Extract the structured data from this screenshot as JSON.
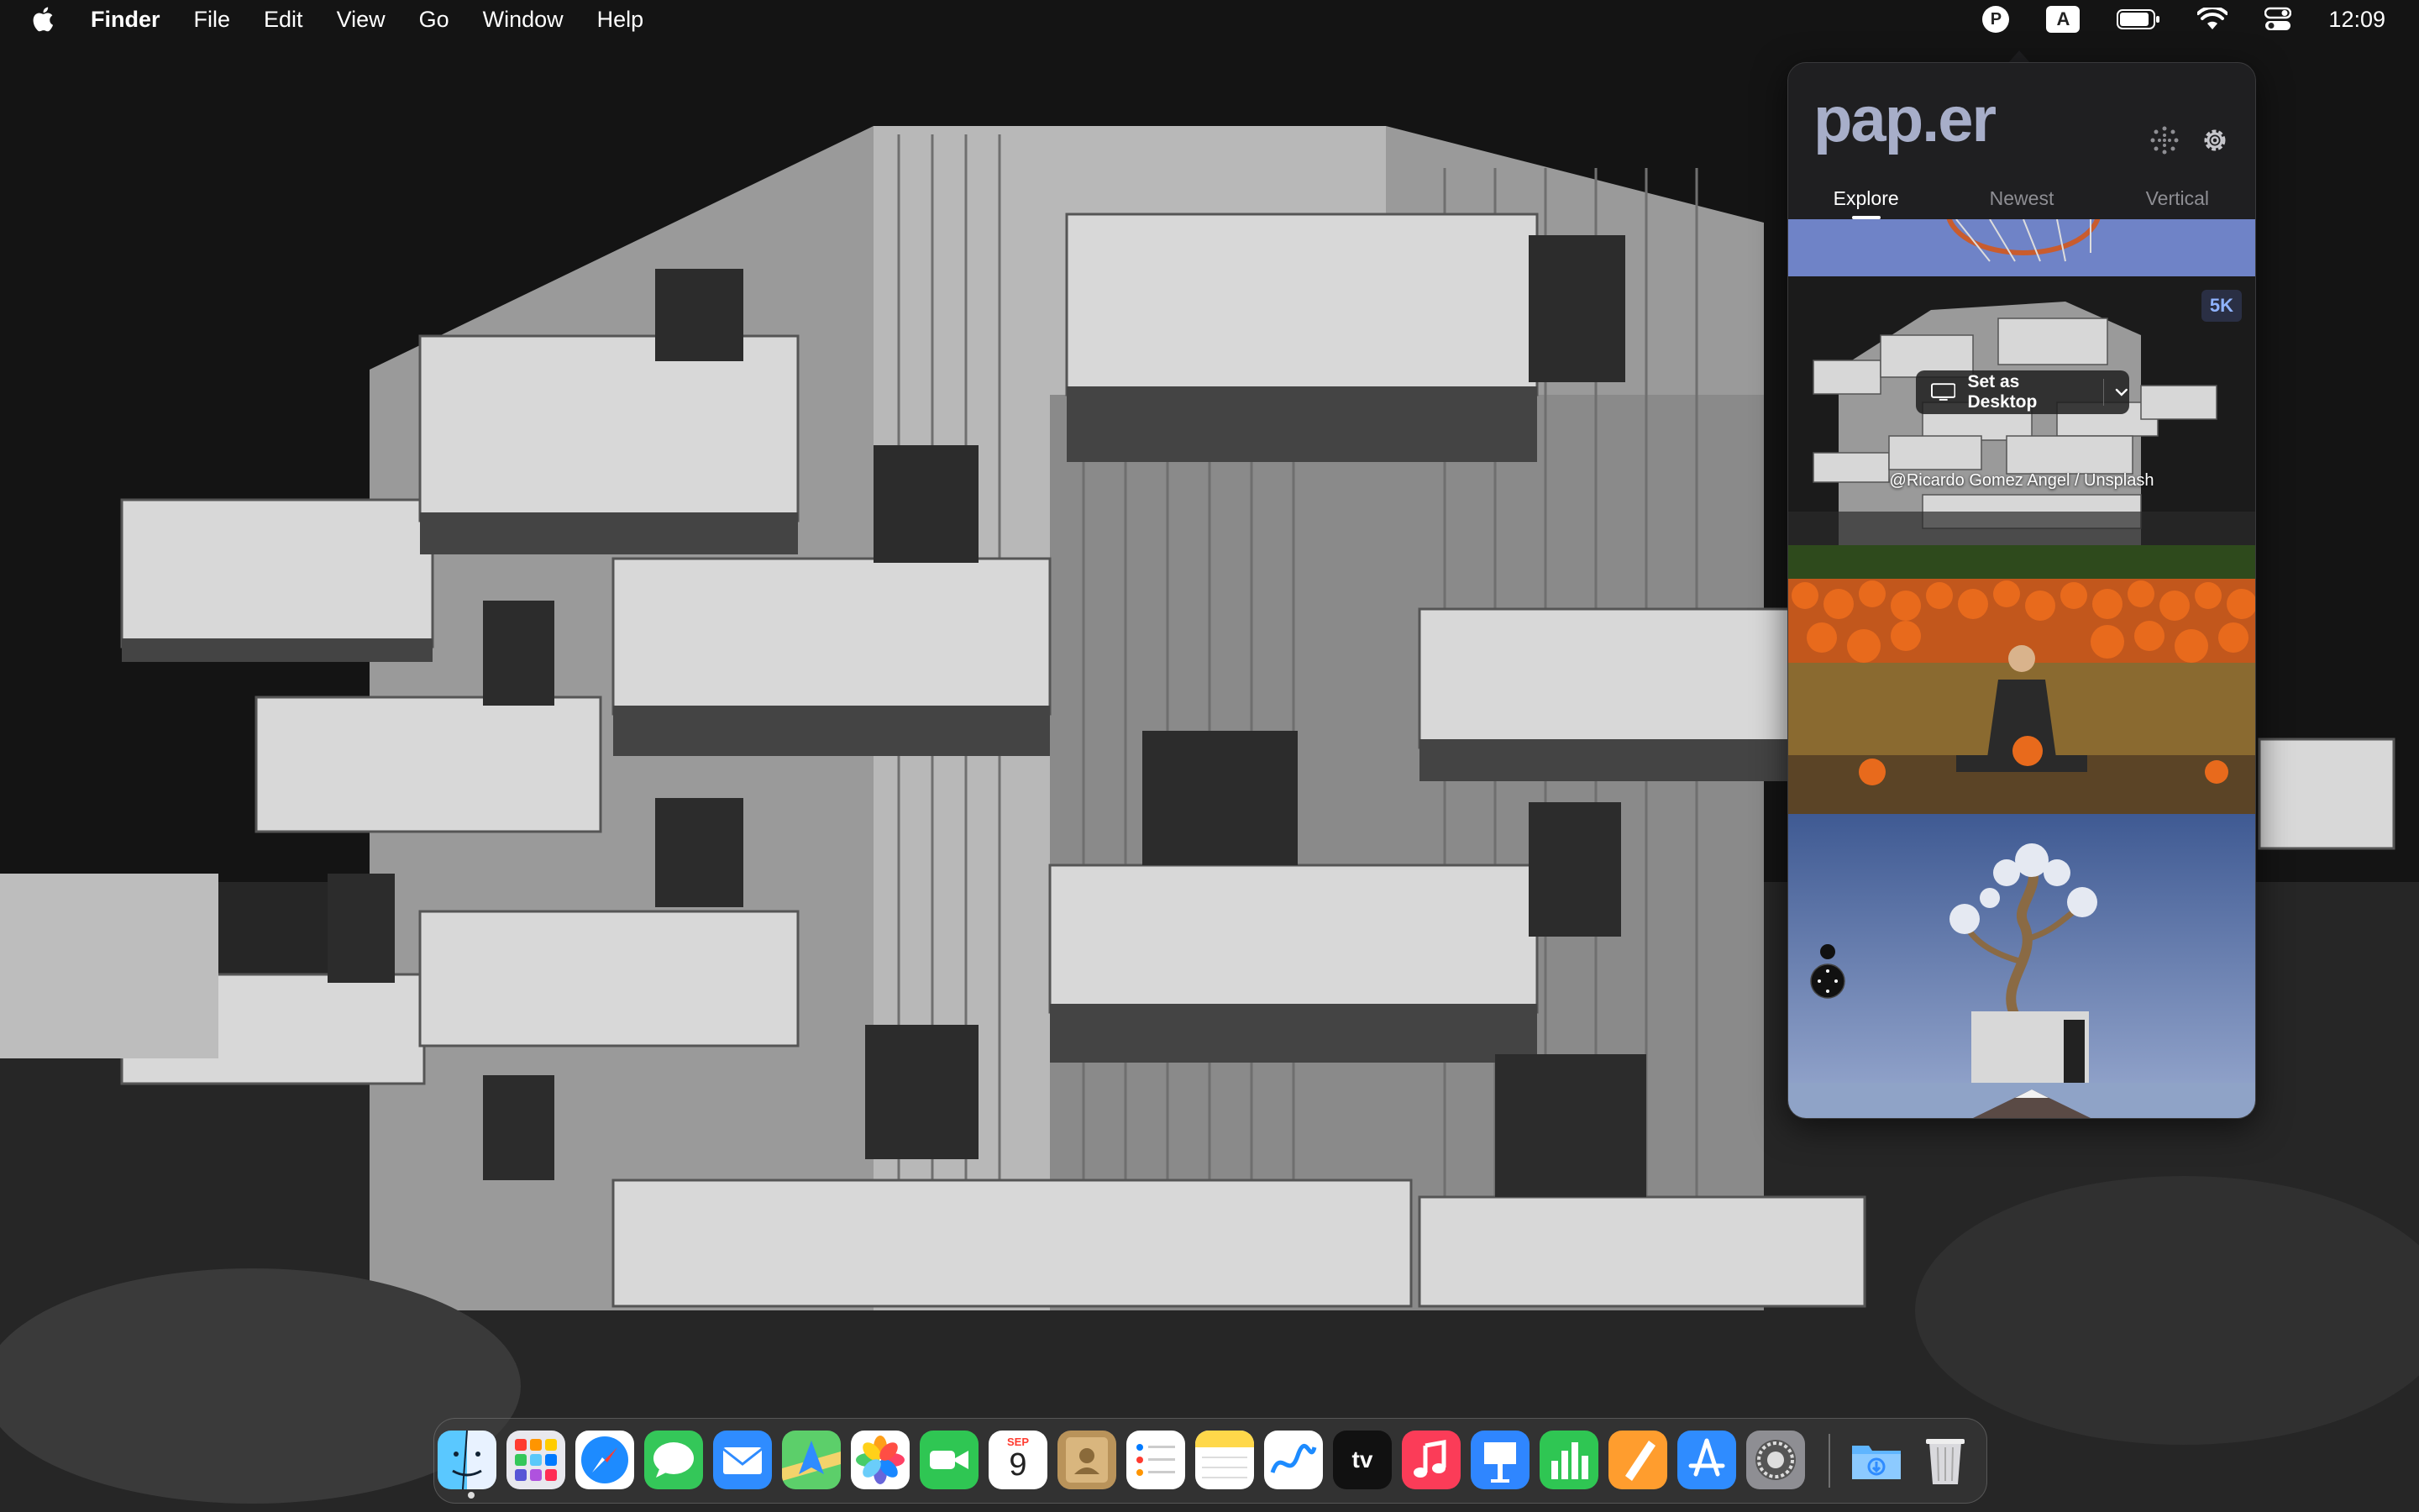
{
  "menubar": {
    "app_name": "Finder",
    "menus": [
      "File",
      "Edit",
      "View",
      "Go",
      "Window",
      "Help"
    ],
    "status": {
      "paper_icon_letter": "P",
      "input_source": "A",
      "clock": "12:09"
    }
  },
  "popover": {
    "logo": "pap.er",
    "tabs": [
      {
        "label": "Explore",
        "active": true
      },
      {
        "label": "Newest",
        "active": false
      },
      {
        "label": "Vertical",
        "active": false
      }
    ],
    "featured": {
      "resolution_badge": "5K",
      "set_desktop_label": "Set as Desktop",
      "credit": "@Ricardo Gomez Angel / Unsplash"
    },
    "icons": {
      "loading": "spinner-icon",
      "settings": "gear-icon"
    }
  },
  "dock": {
    "apps": [
      {
        "name": "Finder",
        "icon": "finder-icon",
        "color": "#3aa0ff"
      },
      {
        "name": "Launchpad",
        "icon": "launchpad-icon",
        "color": "#e8e8ee"
      },
      {
        "name": "Safari",
        "icon": "safari-icon",
        "color": "#1d8bff"
      },
      {
        "name": "Messages",
        "icon": "messages-icon",
        "color": "#34c759"
      },
      {
        "name": "Mail",
        "icon": "mail-icon",
        "color": "#2f8cff"
      },
      {
        "name": "Maps",
        "icon": "maps-icon",
        "color": "#5ccf6a"
      },
      {
        "name": "Photos",
        "icon": "photos-icon",
        "color": "#ffffff"
      },
      {
        "name": "FaceTime",
        "icon": "facetime-icon",
        "color": "#2fc653"
      },
      {
        "name": "Calendar",
        "icon": "calendar-icon",
        "color": "#ffffff",
        "month": "SEP",
        "day": "9"
      },
      {
        "name": "Contacts",
        "icon": "contacts-icon",
        "color": "#b9935a"
      },
      {
        "name": "Reminders",
        "icon": "reminders-icon",
        "color": "#ffffff"
      },
      {
        "name": "Notes",
        "icon": "notes-icon",
        "color": "#ffd84a"
      },
      {
        "name": "Freeform",
        "icon": "freeform-icon",
        "color": "#ffffff"
      },
      {
        "name": "TV",
        "icon": "appletv-icon",
        "color": "#111111",
        "label": "tv"
      },
      {
        "name": "Music",
        "icon": "music-icon",
        "color": "#fb3c58"
      },
      {
        "name": "Keynote",
        "icon": "keynote-icon",
        "color": "#2f86ff"
      },
      {
        "name": "Numbers",
        "icon": "numbers-icon",
        "color": "#2fc653"
      },
      {
        "name": "Pages",
        "icon": "pages-icon",
        "color": "#ff9d2e"
      },
      {
        "name": "App Store",
        "icon": "appstore-icon",
        "color": "#2f8cff"
      },
      {
        "name": "System Settings",
        "icon": "system-settings-icon",
        "color": "#8e8e93"
      },
      {
        "name": "Downloads",
        "icon": "downloads-folder-icon",
        "color": "#5fb5ff"
      },
      {
        "name": "Trash",
        "icon": "trash-icon",
        "color": "#d9d9dd"
      }
    ]
  }
}
